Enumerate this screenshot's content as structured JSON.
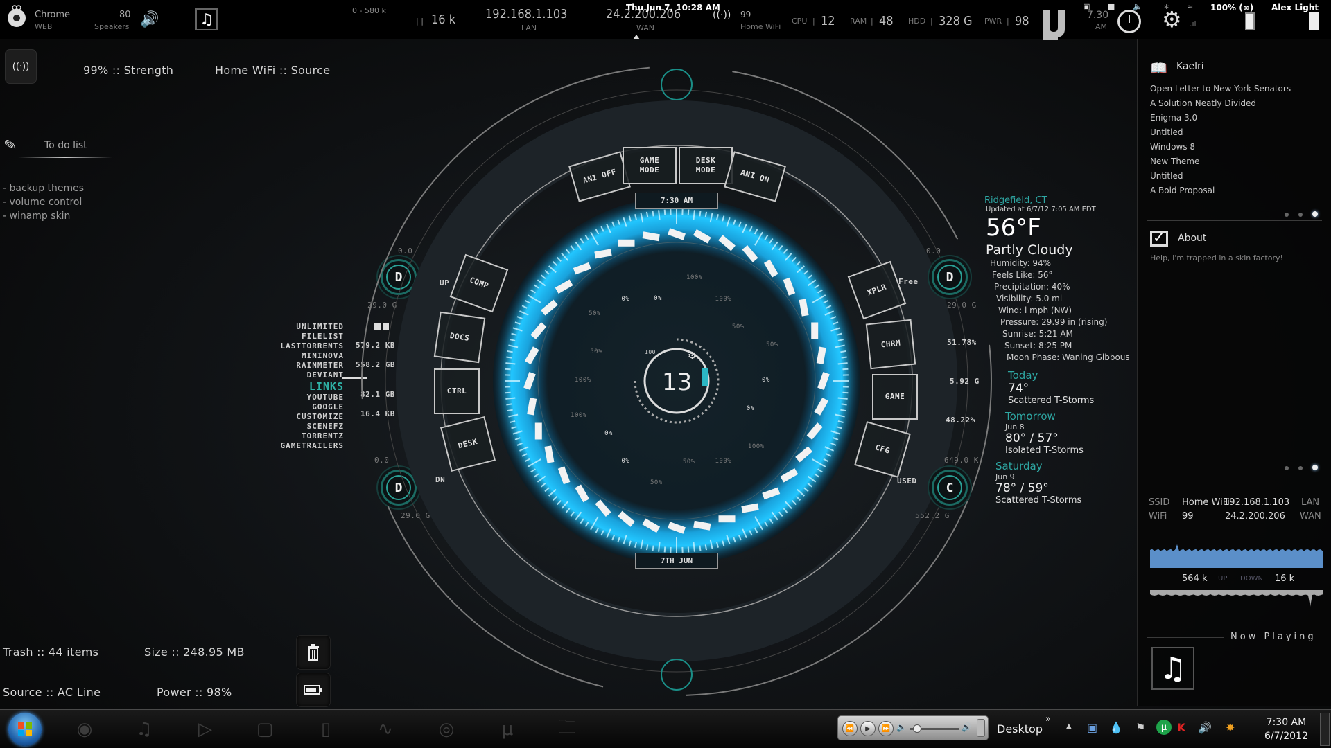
{
  "topbar": {
    "chrome": {
      "label": "Chrome",
      "sub": "WEB"
    },
    "speakers": {
      "value": "80",
      "label": "Speakers"
    },
    "net_range": "0 - 580 k",
    "net_current": "16 k",
    "lan": {
      "value": "192.168.1.103",
      "label": "LAN"
    },
    "wan": {
      "value": "24.2.200.206",
      "label": "WAN"
    },
    "datetime": "Thu Jun  7, 10:28 AM",
    "wifi": {
      "value": "99",
      "label": "Home WiFi"
    },
    "cpu": {
      "label": "CPU",
      "value": "12"
    },
    "ram": {
      "label": "RAM",
      "value": "48"
    },
    "hdd": {
      "label": "HDD",
      "value": "328 G"
    },
    "pwr": {
      "label": "PWR",
      "value": "98"
    },
    "clock": {
      "time": "7.30",
      "ampm": "AM"
    },
    "battery_status": "100% (∞)",
    "user": "Alex Light"
  },
  "wifi_widget": {
    "strength": "99% :: Strength",
    "source": "Home WiFi  ::  Source"
  },
  "todo": {
    "title": "To do list",
    "items": [
      "- backup themes",
      "- volume control",
      "- winamp skin"
    ]
  },
  "links": {
    "top": [
      "UNLIMITED",
      "FILELIST",
      "LASTTORRENTS",
      "MININOVA",
      "RAINMETER",
      "DEVIANT"
    ],
    "header": "LINKS",
    "bottom": [
      "YOUTUBE",
      "GOOGLE",
      "CUSTOMIZE",
      "SCENEFZ",
      "TORRENTZ",
      "GAMETRAILERS"
    ]
  },
  "left_stats": {
    "drive_top": {
      "letter": "D",
      "top_label": "0.0",
      "bottom_label": "29.0 G"
    },
    "drive_bottom": {
      "letter": "D",
      "top_label": "0.0",
      "bottom_label": "29.0 G"
    },
    "values": [
      "579.2 KB",
      "558.2 GB",
      "82.1 GB",
      "16.4 KB"
    ]
  },
  "right_stats": {
    "drive_top": {
      "letter": "D",
      "top_label": "0.0",
      "bottom_label": "29.0 G"
    },
    "drive_bottom": {
      "letter": "C",
      "top_label": "649.0 K",
      "bottom_label": "552.2 G"
    },
    "values": [
      "51.78%",
      "5.92 G",
      "48.22%"
    ]
  },
  "hud": {
    "top_buttons": [
      "ANI OFF",
      "GAME\nMODE",
      "DESK\nMODE",
      "ANI ON"
    ],
    "left_buttons": [
      "COMP",
      "DOCS",
      "CTRL",
      "DESK"
    ],
    "right_buttons": [
      "XPLR",
      "CHRM",
      "GAME",
      "CFG"
    ],
    "left_labels": {
      "up": "UP",
      "down": "DN"
    },
    "right_labels": {
      "up": "Free",
      "down": "USED"
    },
    "time": "7:30   AM",
    "date": "7TH   JUN",
    "center_value": "13",
    "center_small": "100",
    "ring_labels": [
      "100%",
      "100%",
      "50%",
      "50%",
      "0%",
      "0%",
      "100%",
      "100%",
      "50%",
      "50%",
      "0%",
      "0%",
      "100%",
      "100%",
      "50%",
      "50%",
      "0%",
      "0%"
    ]
  },
  "weather": {
    "location": "Ridgefield, CT",
    "updated": "Updated at 6/7/12 7:05 AM EDT",
    "temp": "56°F",
    "condition": "Partly Cloudy",
    "details": [
      "Humidity: 94%",
      "Feels Like: 56°",
      "Precipitation: 40%",
      "Visibility: 5.0 mi",
      "Wind: l mph (NW)",
      "Pressure: 29.99 in (rising)",
      "Sunrise: 5:21 AM",
      "Sunset:  8:25 PM",
      "Moon Phase: Waning Gibbous"
    ],
    "forecast": [
      {
        "day": "Today",
        "date": "",
        "temps": "74°",
        "cond": "Scattered T-Storms"
      },
      {
        "day": "Tomorrow",
        "date": "Jun 8",
        "temps": "80° / 57°",
        "cond": "Isolated T-Storms"
      },
      {
        "day": "Saturday",
        "date": "Jun 9",
        "temps": "78° / 59°",
        "cond": "Scattered T-Storms"
      }
    ]
  },
  "right_panel": {
    "feed": {
      "title": "Kaelri",
      "items": [
        "Open Letter to New York Senators",
        "A Solution Neatly Divided",
        "Enigma 3.0",
        "Untitled",
        "Windows 8",
        "New Theme",
        "Untitled",
        "A Bold Proposal"
      ],
      "pages": 3,
      "active_page": 3
    },
    "about": {
      "title": "About",
      "text": "Help, I'm trapped in a skin factory!",
      "pages": 3,
      "active_page": 3
    },
    "network": {
      "ssid_label": "SSID",
      "ssid": "Home WiFi",
      "lan_ip": "192.168.1.103",
      "lan_label": "LAN",
      "wifi_label": "WiFi",
      "wifi": "99",
      "wan_ip": "24.2.200.206",
      "wan_label": "WAN",
      "up_value": "564 k",
      "up_label": "UP",
      "down_label": "DOWN",
      "down_value": "16 k",
      "accent": "#5b8fc9"
    },
    "now_playing": "Now Playing"
  },
  "bottom_left": {
    "trash": "Trash  ::  44 items",
    "size": "Size  ::  248.95 MB",
    "source": "Source  ::  AC Line",
    "power": "Power  ::  98%"
  },
  "taskbar": {
    "apps": [
      "chrome-icon",
      "music-icon",
      "play-icon",
      "app-icon",
      "document-icon",
      "steam-icon",
      "media-icon",
      "utorrent-icon",
      "folder-icon"
    ],
    "desktop_label": "Desktop",
    "time": "7:30 AM",
    "date": "6/7/2012"
  },
  "colors": {
    "accent_cyan": "#1aa9e6",
    "accent_teal": "#2ea7a3",
    "graph_blue": "#5b8fc9"
  }
}
